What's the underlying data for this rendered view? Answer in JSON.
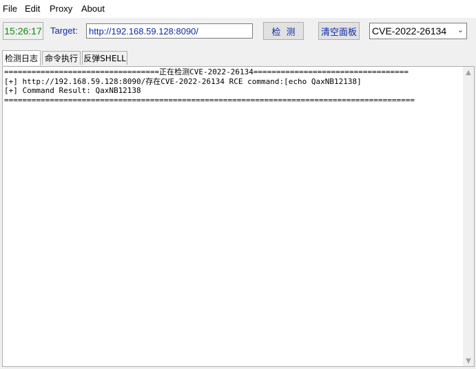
{
  "menu": {
    "file": "File",
    "edit": "Edit",
    "proxy": "Proxy",
    "about": "About"
  },
  "toolbar": {
    "clock": "15:26:17",
    "target_label": "Target:",
    "target_value": "http://192.168.59.128:8090/",
    "detect_label": "检测",
    "clear_label": "清空面板",
    "cve_selected": "CVE-2022-26134"
  },
  "tabs": [
    {
      "label": "检测日志",
      "active": true
    },
    {
      "label": "命令执行",
      "active": false
    },
    {
      "label": "反弹SHELL",
      "active": false
    }
  ],
  "log": {
    "lines": [
      "==================================正在检测CVE-2022-26134==================================",
      "[+] http://192.168.59.128:8090/存在CVE-2022-26134 RCE command:[echo QaxNB12138]",
      "[+] Command Result: QaxNB12138",
      "=========================================================================================="
    ]
  },
  "colors": {
    "clock_text": "#0a8c0a",
    "accent_text": "#0b2aa6",
    "window_bg": "#f0f0f0"
  }
}
